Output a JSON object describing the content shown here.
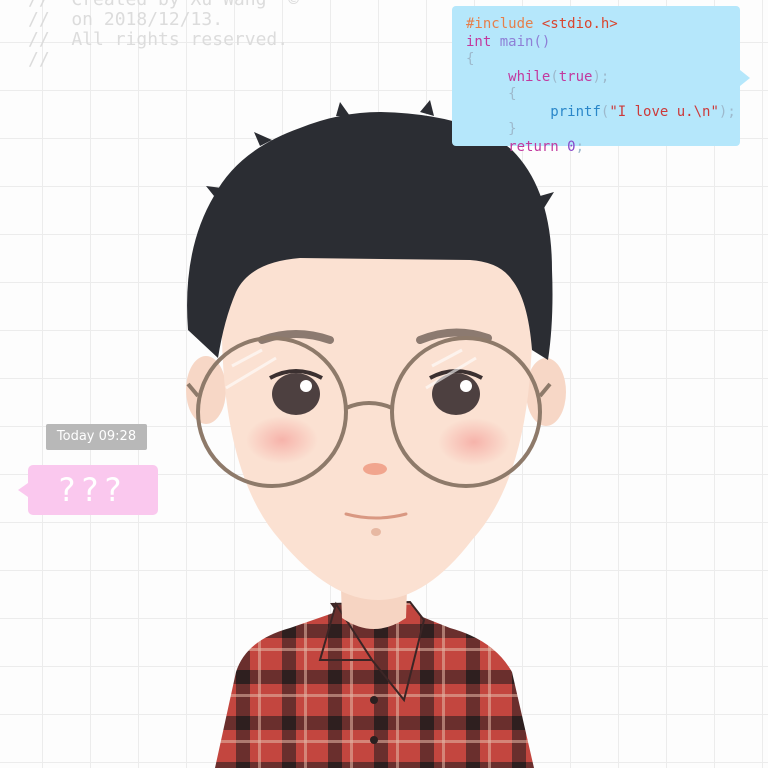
{
  "header_comment": {
    "lines": [
      "//  Created by Xu Wang  ©",
      "//  on 2018/12/13.",
      "//  All rights reserved.",
      "//"
    ]
  },
  "code_bubble": {
    "include_directive": "#include",
    "include_file": "<stdio.h>",
    "type_keyword": "int",
    "main_name": "main()",
    "open_brace": "{",
    "while_keyword": "while",
    "paren_open": "(",
    "true_value": "true",
    "paren_close": ");",
    "inner_open_brace": "{",
    "printf_name": "printf",
    "printf_paren_open": "(",
    "printf_string": "\"I love u.\\n\"",
    "printf_paren_close": ");",
    "inner_close_brace": "}",
    "return_keyword": "return",
    "return_value": "0",
    "semicolon": ";",
    "bubble_color": "#b5e7fb"
  },
  "chat": {
    "timestamp": "Today 09:28",
    "message": "???",
    "bubble_color": "#fac8ee",
    "badge_color": "#b8b8b8"
  },
  "avatar": {
    "description_icon": "cartoon-boy-avatar-icon",
    "colors": {
      "hair": "#2b2d33",
      "skin": "#fbe1d2",
      "glasses": "#8e7a6a",
      "shirt_red": "#c3463f",
      "shirt_dark": "#3a2626"
    }
  }
}
